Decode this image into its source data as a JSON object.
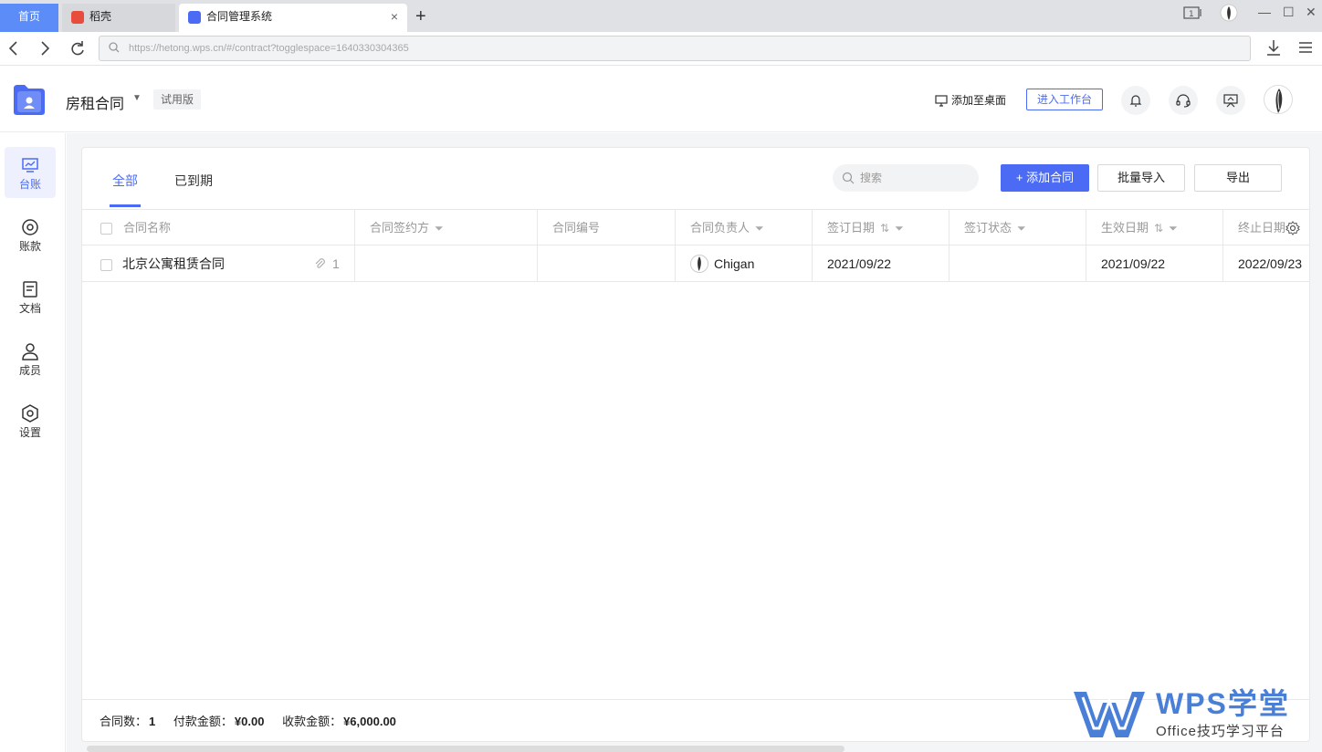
{
  "browser": {
    "home_tab": "首页",
    "tabs": [
      {
        "label": "稻壳",
        "favicon_color": "#e84c3d"
      },
      {
        "label": "合同管理系统",
        "favicon_color": "#4b6bf5"
      }
    ],
    "new_tab": "+",
    "close_tab": "×",
    "window_controls": [
      "—",
      "☐",
      "✕"
    ],
    "url": "https://hetong.wps.cn/#/contract?togglespace=1640330304365"
  },
  "app": {
    "name": "房租合同",
    "trial_badge": "试用版",
    "add_to_desktop": "添加至桌面",
    "enter_workspace": "进入工作台",
    "accent": "#4b6bf5"
  },
  "sidebar": {
    "items": [
      {
        "label": "台账",
        "icon": "ledger-icon",
        "active": true
      },
      {
        "label": "账款",
        "icon": "payment-icon"
      },
      {
        "label": "文档",
        "icon": "document-icon"
      },
      {
        "label": "成员",
        "icon": "member-icon"
      },
      {
        "label": "设置",
        "icon": "settings-icon"
      }
    ]
  },
  "content": {
    "tabs": [
      {
        "label": "全部",
        "active": true
      },
      {
        "label": "已到期"
      }
    ],
    "search_placeholder": "搜索",
    "add_contract": "+ 添加合同",
    "batch_import": "批量导入",
    "export": "导出"
  },
  "table": {
    "columns": [
      "合同名称",
      "合同签约方",
      "合同编号",
      "合同负责人",
      "签订日期",
      "签订状态",
      "生效日期",
      "终止日期"
    ],
    "rows": [
      {
        "name": "北京公寓租赁合同",
        "attachments": "1",
        "party": "",
        "number": "",
        "owner": "Chigan",
        "sign_date": "2021/09/22",
        "sign_status": "",
        "effective_date": "2021/09/22",
        "end_date": "2022/09/23"
      }
    ]
  },
  "footer": {
    "count_label": "合同数：",
    "count": "1",
    "paid_label": "付款金额：",
    "paid": "¥0.00",
    "received_label": "收款金额：",
    "received": "¥6,000.00"
  },
  "watermark": {
    "title": "WPS学堂",
    "subtitle": "Office技巧学习平台"
  }
}
